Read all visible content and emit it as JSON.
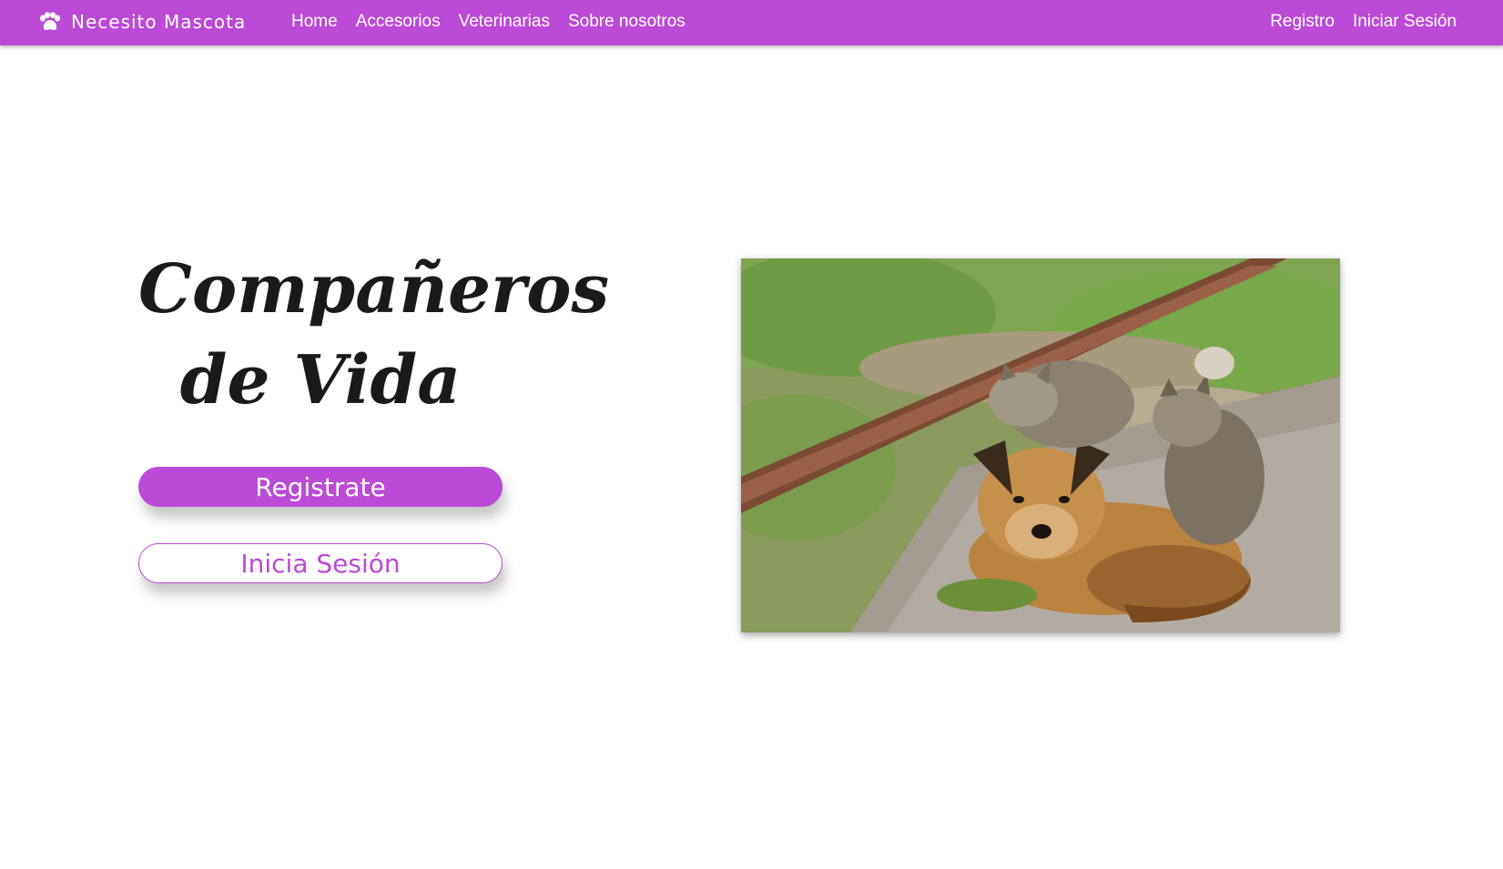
{
  "brand": {
    "name": "Necesito Mascota",
    "icon": "paw-icon"
  },
  "nav": {
    "links": [
      "Home",
      "Accesorios",
      "Veterinarias",
      "Sobre nosotros"
    ],
    "right": [
      "Registro",
      "Iniciar Sesión"
    ]
  },
  "hero": {
    "title_line1": "Compañeros",
    "title_line2": "de Vida",
    "register_button": "Registrate",
    "login_button": "Inicia Sesión"
  },
  "colors": {
    "accent": "#bb4ad6",
    "text": "#1a1a1a",
    "background": "#ffffff"
  }
}
